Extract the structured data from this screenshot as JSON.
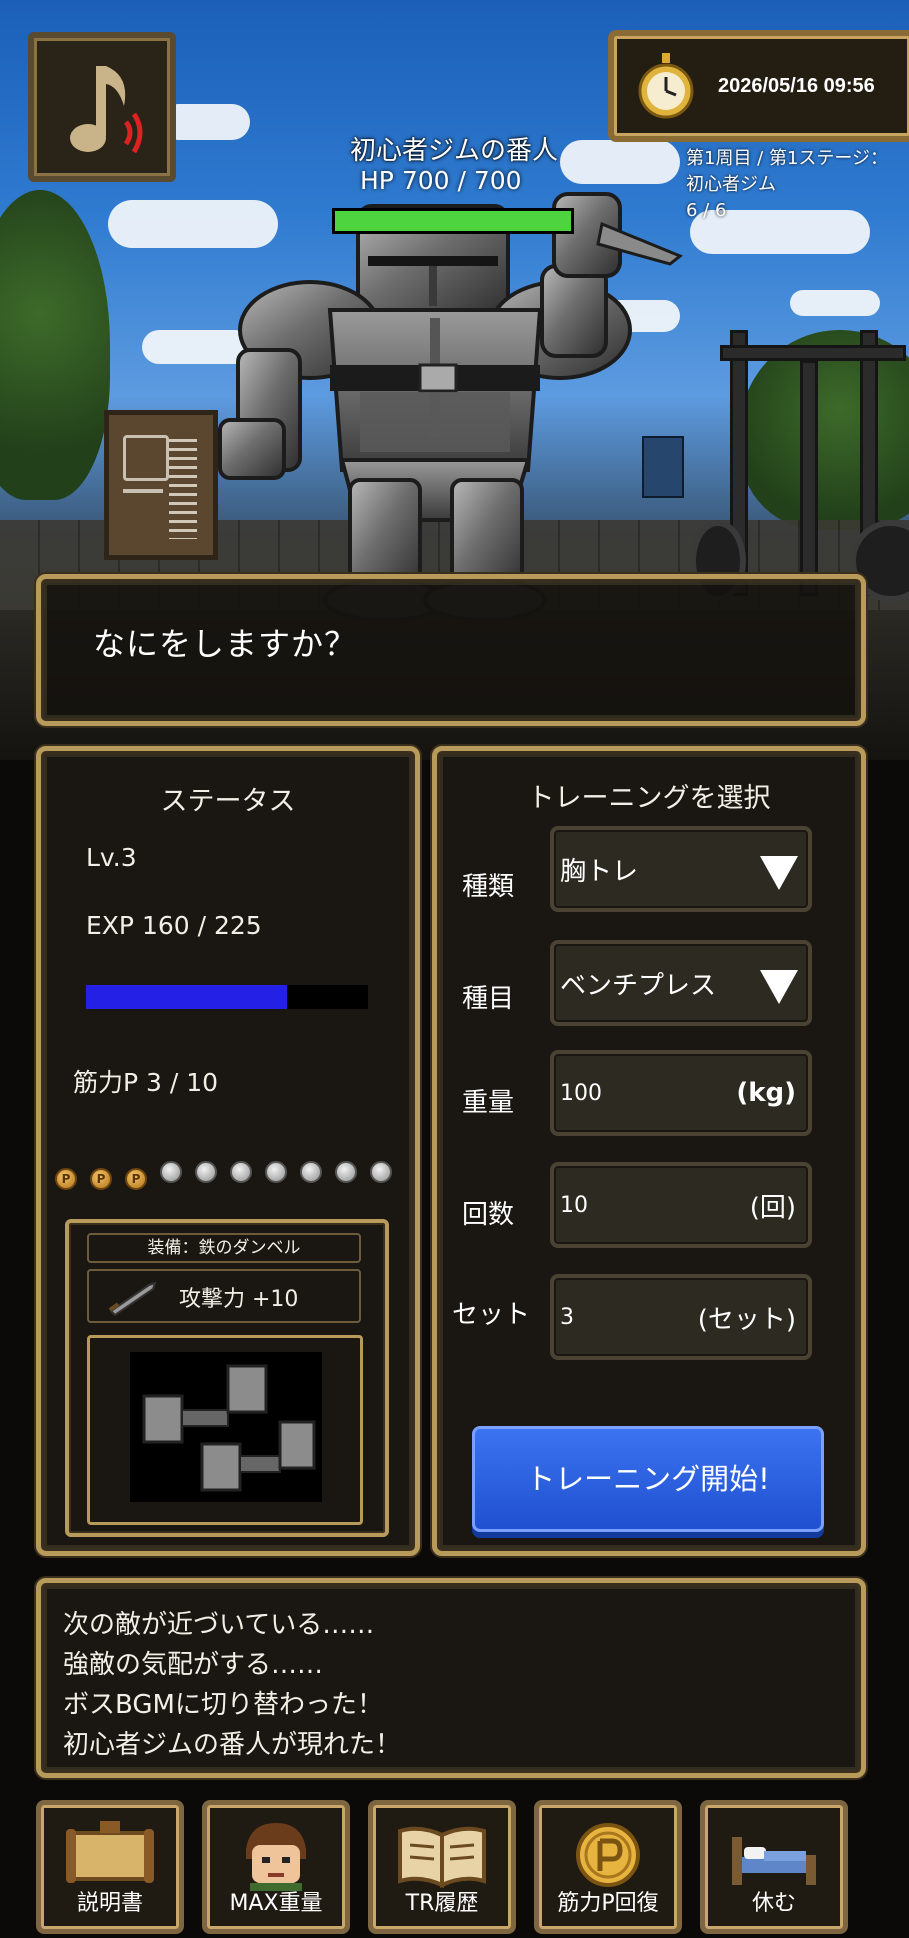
{
  "music_button": {
    "icon": "music-note-sound-icon"
  },
  "clock": {
    "icon": "pocket-watch-icon",
    "datetime": "2026/05/16 09:56"
  },
  "enemy": {
    "name": "初心者ジムの番人",
    "hp_text": "HP 700 / 700",
    "hp_current": 700,
    "hp_max": 700
  },
  "stage_info": {
    "line1": "第1周目 / 第1ステージ：",
    "line2": "初心者ジム",
    "line3": "6 / 6"
  },
  "dialog": {
    "prompt": "なにをしますか？"
  },
  "status": {
    "title": "ステータス",
    "level": "Lv.3",
    "exp_text": "EXP 160 / 225",
    "exp_current": 160,
    "exp_max": 225,
    "strength_text": "筋力P 3 / 10",
    "strength_current": 3,
    "strength_max": 10,
    "equipment": {
      "label": "装備：鉄のダンベル",
      "attack": "攻撃力 +10",
      "sword_icon": "sword-icon",
      "item_icon": "iron-dumbbells-icon"
    }
  },
  "training": {
    "title": "トレーニングを選択",
    "type_label": "種類",
    "type_value": "胸トレ",
    "exercise_label": "種目",
    "exercise_value": "ベンチプレス",
    "weight_label": "重量",
    "weight_value": "100",
    "weight_unit": "(kg)",
    "reps_label": "回数",
    "reps_value": "10",
    "reps_unit": "(回)",
    "sets_label": "セット",
    "sets_value": "3",
    "sets_unit": "(セット)",
    "start_button": "トレーニング開始!"
  },
  "log": {
    "lines": [
      "次の敵が近づいている……",
      "強敵の気配がする……",
      "ボスBGMに切り替わった！",
      "初心者ジムの番人が現れた！"
    ]
  },
  "nav": [
    {
      "label": "説明書",
      "icon": "scroll-sign-icon"
    },
    {
      "label": "MAX重量",
      "icon": "hero-face-icon"
    },
    {
      "label": "TR履歴",
      "icon": "open-book-icon"
    },
    {
      "label": "筋力P回復",
      "icon": "p-coin-icon"
    },
    {
      "label": "休む",
      "icon": "bed-icon"
    }
  ],
  "colors": {
    "hp": "#4dd43f",
    "exp": "#2420e6",
    "start_button": "#2a62e6",
    "frame": "#b89a5a"
  }
}
